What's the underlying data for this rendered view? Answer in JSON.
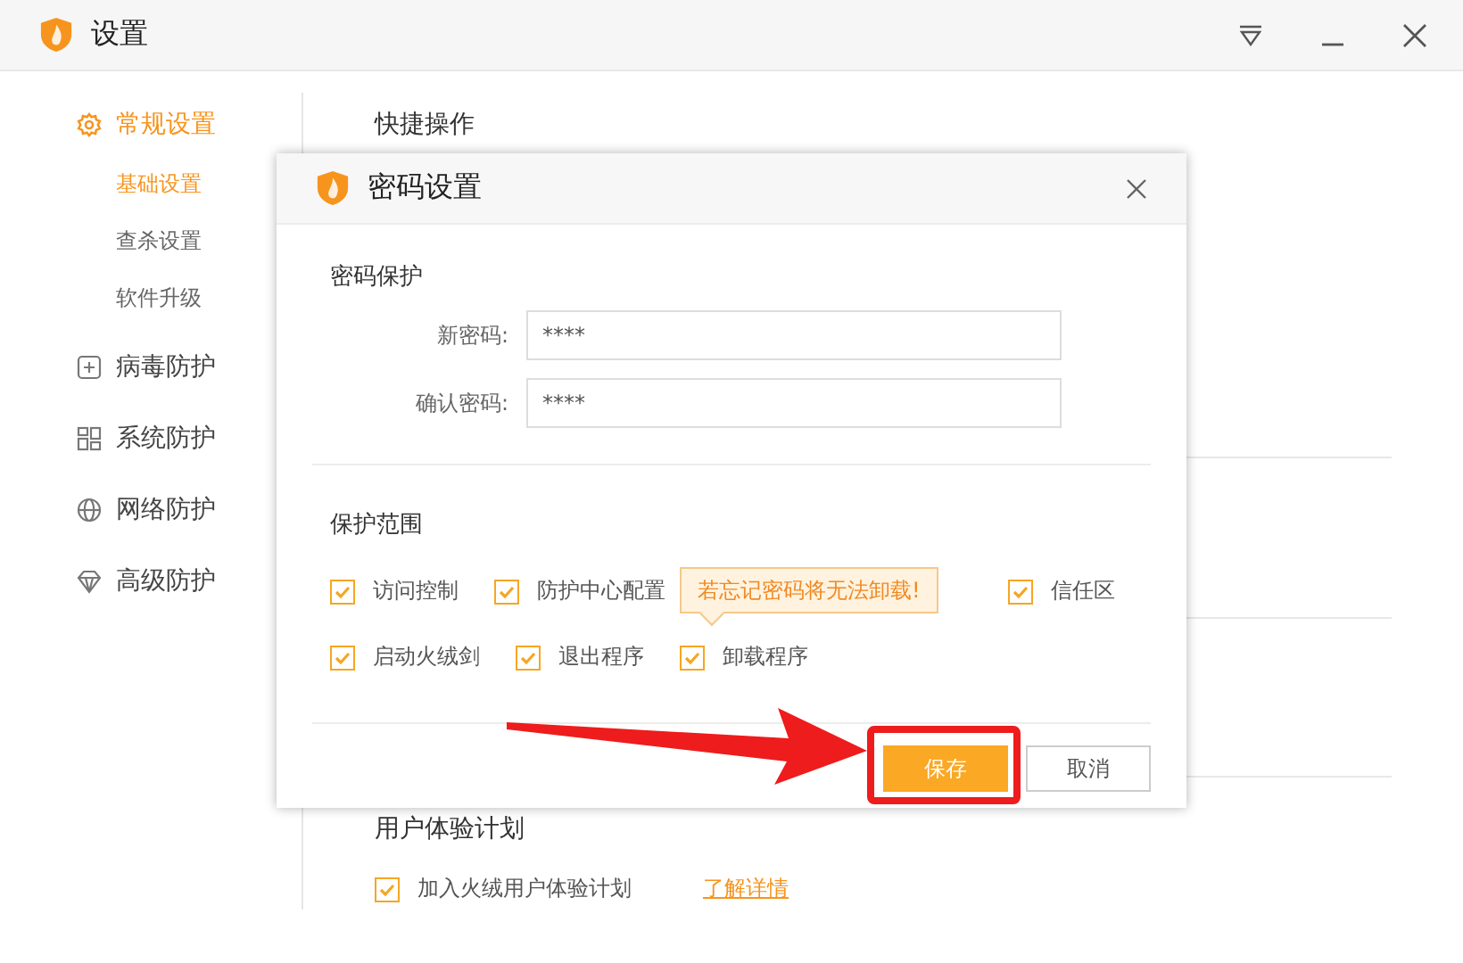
{
  "window": {
    "title": "设置"
  },
  "sidebar": {
    "items": [
      {
        "label": "常规设置",
        "selected": true,
        "children": [
          {
            "label": "基础设置",
            "selected": true
          },
          {
            "label": "查杀设置",
            "selected": false
          },
          {
            "label": "软件升级",
            "selected": false
          }
        ]
      },
      {
        "label": "病毒防护",
        "selected": false
      },
      {
        "label": "系统防护",
        "selected": false
      },
      {
        "label": "网络防护",
        "selected": false
      },
      {
        "label": "高级防护",
        "selected": false
      }
    ]
  },
  "main": {
    "section_title": "快捷操作",
    "user_plan": {
      "title": "用户体验计划",
      "checkbox": {
        "label": "加入火绒用户体验计划",
        "checked": true
      },
      "link": "了解详情"
    }
  },
  "dialog": {
    "title": "密码设置",
    "password": {
      "title": "密码保护",
      "fields": [
        {
          "label": "新密码:",
          "value": "****"
        },
        {
          "label": "确认密码:",
          "value": "****"
        }
      ]
    },
    "scope": {
      "title": "保护范围",
      "rows": [
        [
          {
            "label": "访问控制",
            "checked": true
          },
          {
            "label": "防护中心配置",
            "checked": true
          },
          {
            "label": "信任区",
            "checked": true
          }
        ],
        [
          {
            "label": "启动火绒剑",
            "checked": true
          },
          {
            "label": "退出程序",
            "checked": true
          },
          {
            "label": "卸载程序",
            "checked": true
          }
        ]
      ]
    },
    "tooltip": "若忘记密码将无法卸载!",
    "buttons": [
      {
        "label": "保存",
        "kind": "primary"
      },
      {
        "label": "取消",
        "kind": "secondary"
      }
    ]
  }
}
